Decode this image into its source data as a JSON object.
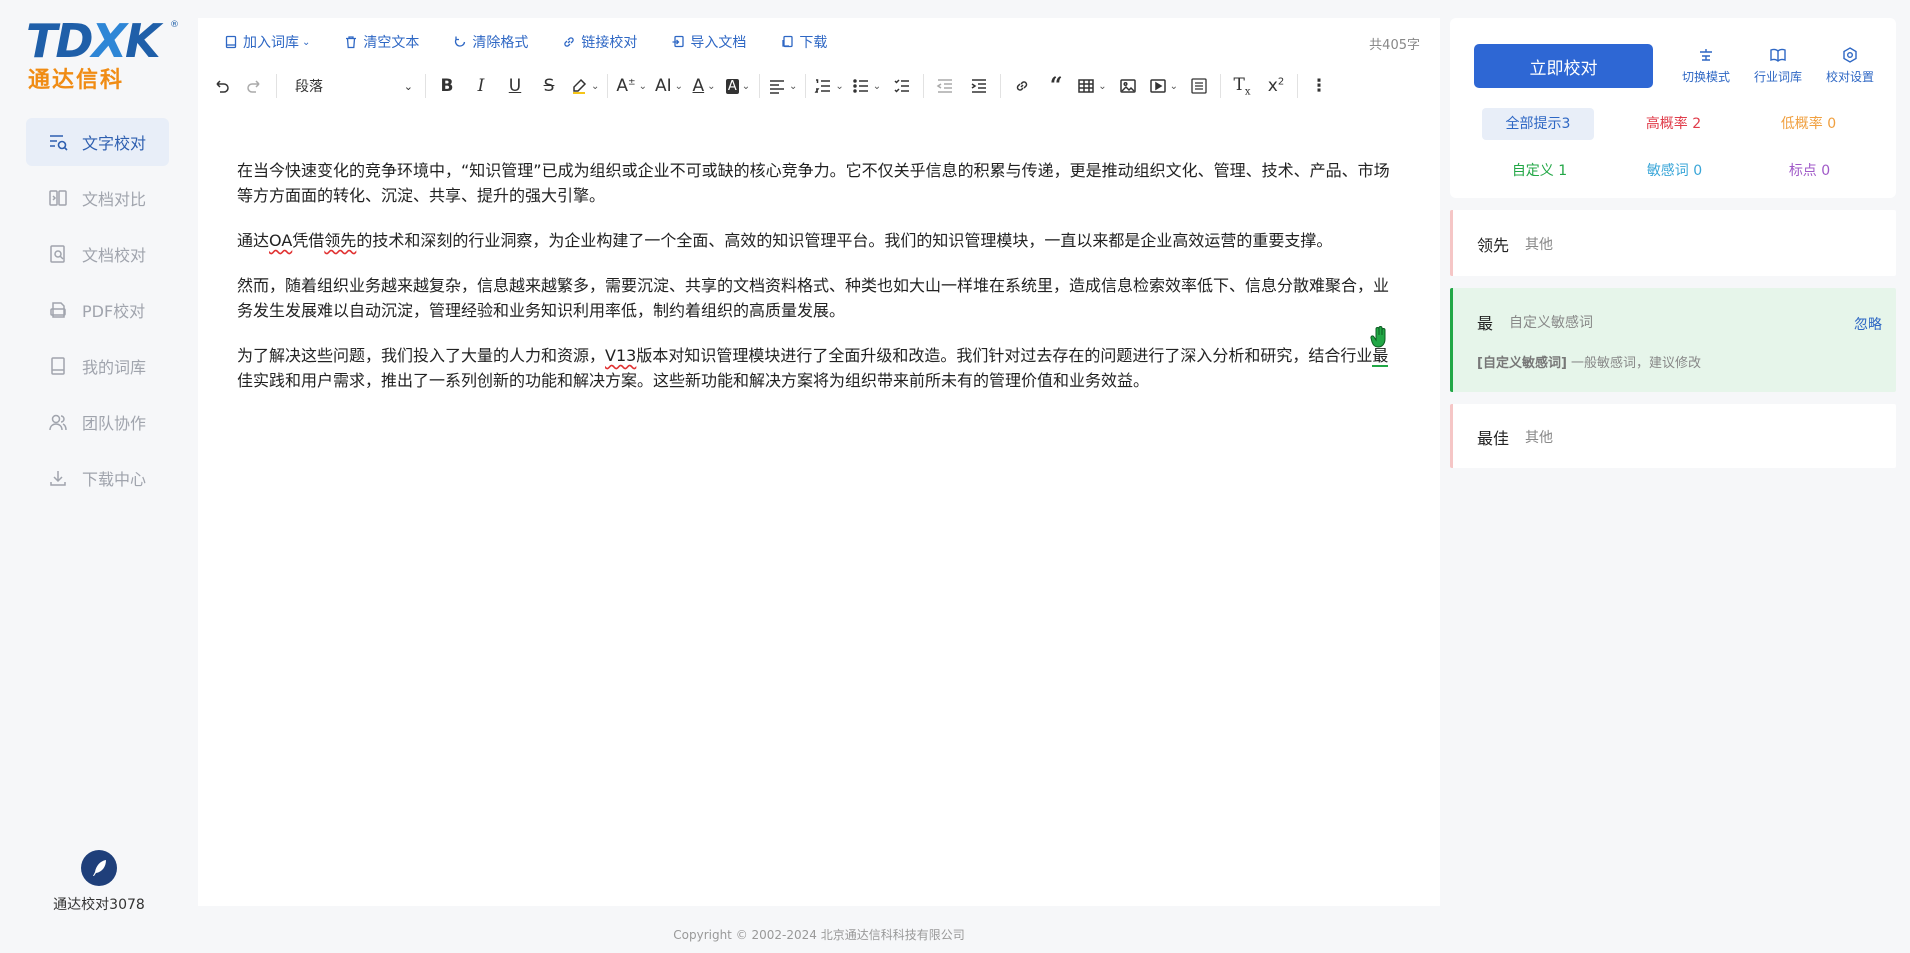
{
  "brand": {
    "logo_text": "TDXK",
    "logo_cn": "通达信科",
    "bottom_label": "通达校对3078"
  },
  "sidebar": {
    "items": [
      {
        "label": "文字校对",
        "active": true,
        "icon": "text-search-icon"
      },
      {
        "label": "文档对比",
        "active": false,
        "icon": "compare-icon"
      },
      {
        "label": "文档校对",
        "active": false,
        "icon": "doc-search-icon"
      },
      {
        "label": "PDF校对",
        "active": false,
        "icon": "pdf-icon"
      },
      {
        "label": "我的词库",
        "active": false,
        "icon": "book-icon"
      },
      {
        "label": "团队协作",
        "active": false,
        "icon": "team-icon"
      },
      {
        "label": "下载中心",
        "active": false,
        "icon": "download-icon"
      }
    ]
  },
  "actions": {
    "add_lexicon": "加入词库",
    "clear_text": "清空文本",
    "clear_format": "清除格式",
    "link_proof": "链接校对",
    "import_doc": "导入文档",
    "download": "下载"
  },
  "word_count": "共405字",
  "toolbar": {
    "paragraph_select": "段落"
  },
  "content": {
    "p1": "在当今快速变化的竞争环境中，“知识管理”已成为组织或企业不可或缺的核心竞争力。它不仅关乎信息的积累与传递，更是推动组织文化、管理、技术、产品、市场等方方面面的转化、沉淀、共享、提升的强大引擎。",
    "p2_a": "通达",
    "p2_oa": "OA",
    "p2_b": "凭借",
    "p2_lead": "领先",
    "p2_c": "的技术和深刻的行业洞察，为企业构建了一个全面、高效的知识管理平台。我们的知识管理模块，一直以来都是企业高效运营的重要支撑。",
    "p3": "然而，随着组织业务越来越复杂，信息越来越繁多，需要沉淀、共享的文档资料格式、种类也如大山一样堆在系统里，造成信息检索效率低下、信息分散难聚合，业务发生发展难以自动沉淀，管理经验和业务知识利用率低，制约着组织的高质量发展。",
    "p4_a": "为了解决这些问题，我们投入了大量的人力和资源，",
    "p4_v13": "V13",
    "p4_b": "版本对知识管理模块进行了全面升级和改造。我们针对过去存在的问题进行了深入分析和研究，结合行业",
    "p4_best": "最",
    "p4_c": "佳实践和用户需求，推出了一系列创新的功能和解决方案。这些新功能和解决方案将为组织带来前所未有的管理价值和业务效益。"
  },
  "copyright": "Copyright © 2002-2024 北京通达信科科技有限公司",
  "panel": {
    "proof_button": "立即校对",
    "switch_mode": "切换模式",
    "industry_lexicon": "行业词库",
    "proof_settings": "校对设置",
    "filters": [
      {
        "label": "全部提示3",
        "color": "#2e67c4"
      },
      {
        "label": "高概率 2",
        "color": "#e03c4a"
      },
      {
        "label": "低概率 0",
        "color": "#f0a040"
      },
      {
        "label": "自定义 1",
        "color": "#22a746"
      },
      {
        "label": "敏感词 0",
        "color": "#3aa6d8"
      },
      {
        "label": "标点 0",
        "color": "#a05ac8"
      }
    ]
  },
  "cards": [
    {
      "word": "领先",
      "tag": "其他"
    },
    {
      "word": "最",
      "tag": "自定义敏感词",
      "ignore": "忽略",
      "note_tag": "[自定义敏感词]",
      "note": " 一般敏感词，建议修改"
    },
    {
      "word": "最佳",
      "tag": "其他"
    }
  ]
}
